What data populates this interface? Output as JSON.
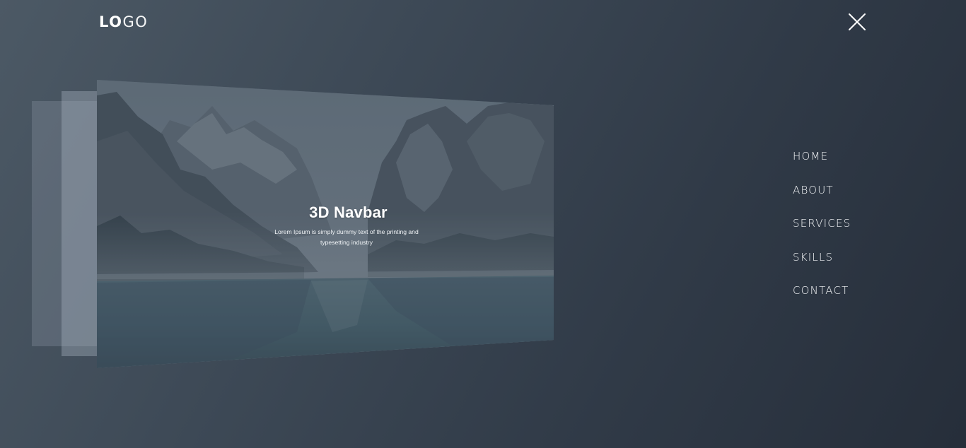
{
  "header": {
    "logo_bold": "LO",
    "logo_light": "GO",
    "close_icon": "close-icon"
  },
  "hero": {
    "title": "3D Navbar",
    "text": "Lorem Ipsum is simply dummy text of the printing and typesetting industry",
    "image": "mountain-lake-image"
  },
  "nav": {
    "items": [
      {
        "label": "HOME"
      },
      {
        "label": "ABOUT"
      },
      {
        "label": "SERVICES"
      },
      {
        "label": "SKILLS"
      },
      {
        "label": "CONTACT"
      }
    ]
  },
  "colors": {
    "background_start": "#4c5965",
    "background_end": "#262e3a",
    "text": "#ffffff"
  }
}
